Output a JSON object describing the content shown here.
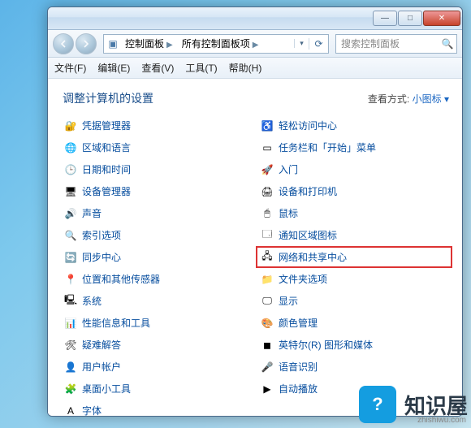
{
  "title_controls": {
    "min": "—",
    "max": "□",
    "close": "✕"
  },
  "breadcrumb": {
    "root": "控制面板",
    "leaf": "所有控制面板项"
  },
  "search": {
    "placeholder": "搜索控制面板"
  },
  "menu": {
    "file": "文件(F)",
    "edit": "编辑(E)",
    "view": "查看(V)",
    "tools": "工具(T)",
    "help": "帮助(H)"
  },
  "heading": "调整计算机的设置",
  "viewby": {
    "label": "查看方式:",
    "value": "小图标",
    "arrow": "▾"
  },
  "items_left": [
    {
      "label": "凭据管理器",
      "icon": "🔐"
    },
    {
      "label": "区域和语言",
      "icon": "🌐"
    },
    {
      "label": "日期和时间",
      "icon": "🕒"
    },
    {
      "label": "设备管理器",
      "icon": "🖥"
    },
    {
      "label": "声音",
      "icon": "🔊"
    },
    {
      "label": "索引选项",
      "icon": "🔍"
    },
    {
      "label": "同步中心",
      "icon": "🔄"
    },
    {
      "label": "位置和其他传感器",
      "icon": "📍"
    },
    {
      "label": "系统",
      "icon": "🖳"
    },
    {
      "label": "性能信息和工具",
      "icon": "📊"
    },
    {
      "label": "疑难解答",
      "icon": "🛠"
    },
    {
      "label": "用户帐户",
      "icon": "👤"
    },
    {
      "label": "桌面小工具",
      "icon": "🧩"
    },
    {
      "label": "字体",
      "icon": "A"
    }
  ],
  "items_right": [
    {
      "label": "轻松访问中心",
      "icon": "♿"
    },
    {
      "label": "任务栏和「开始」菜单",
      "icon": "▭"
    },
    {
      "label": "入门",
      "icon": "🚀"
    },
    {
      "label": "设备和打印机",
      "icon": "🖨"
    },
    {
      "label": "鼠标",
      "icon": "🖱"
    },
    {
      "label": "通知区域图标",
      "icon": "🗔"
    },
    {
      "label": "网络和共享中心",
      "icon": "🖧",
      "highlight": true
    },
    {
      "label": "文件夹选项",
      "icon": "📁"
    },
    {
      "label": "显示",
      "icon": "🖵"
    },
    {
      "label": "颜色管理",
      "icon": "🎨"
    },
    {
      "label": "英特尔(R) 图形和媒体",
      "icon": "◼"
    },
    {
      "label": "语音识别",
      "icon": "🎤"
    },
    {
      "label": "自动播放",
      "icon": "▶"
    }
  ],
  "watermark": {
    "brand": "知识屋",
    "url": "zhishiwu.com"
  }
}
